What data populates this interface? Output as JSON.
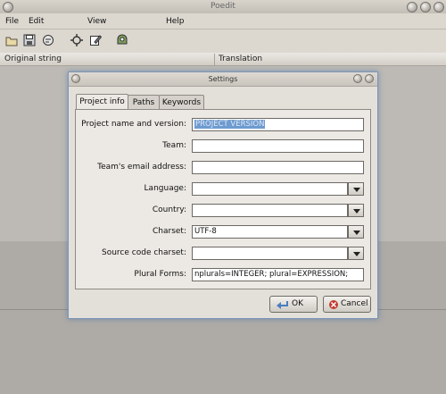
{
  "main_window": {
    "title": "Poedit",
    "menu": [
      "File",
      "Edit",
      "View",
      "Help"
    ],
    "columns": [
      "Original string",
      "Translation"
    ],
    "toolbar_icons": [
      "open-icon",
      "save-icon",
      "catalog-icon",
      "validate-icon",
      "edit-comment-icon",
      "update-icon"
    ]
  },
  "dialog": {
    "title": "Settings",
    "tabs": [
      "Project info",
      "Paths",
      "Keywords"
    ],
    "fields": {
      "project_name": {
        "label": "Project name and version:",
        "value": "PROJECT VERSION"
      },
      "team": {
        "label": "Team:",
        "value": ""
      },
      "team_email": {
        "label": "Team's email address:",
        "value": ""
      },
      "language": {
        "label": "Language:",
        "value": ""
      },
      "country": {
        "label": "Country:",
        "value": ""
      },
      "charset": {
        "label": "Charset:",
        "value": "UTF-8"
      },
      "source_charset": {
        "label": "Source code charset:",
        "value": ""
      },
      "plural_forms": {
        "label": "Plural Forms:",
        "value": "nplurals=INTEGER; plural=EXPRESSION;"
      }
    },
    "ok_label": "OK",
    "cancel_label": "Cancel"
  },
  "colors": {
    "selection": "#6e9bd0",
    "dialog_border": "#7c97b8",
    "ok_icon": "#4a7fc0",
    "cancel_icon": "#c23b2f"
  }
}
